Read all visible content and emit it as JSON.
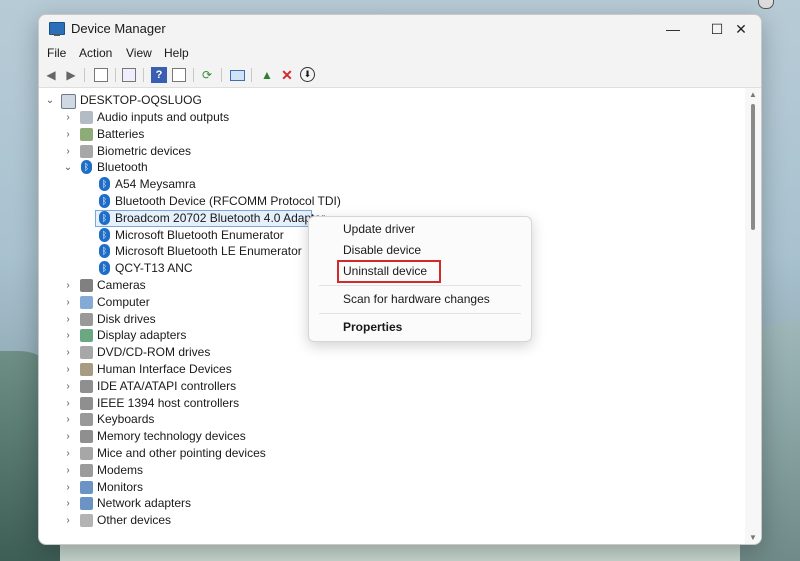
{
  "window": {
    "title": "Device Manager",
    "controls": {
      "minimize": "—",
      "maximize": "☐",
      "close": "✕"
    }
  },
  "menubar": [
    "File",
    "Action",
    "View",
    "Help"
  ],
  "toolbar": {
    "buttons": [
      "back-icon",
      "forward-icon",
      "properties-icon",
      "list-icon",
      "help-icon",
      "details-icon",
      "scan-icon",
      "monitor-icon",
      "update-driver-icon",
      "uninstall-icon",
      "download-icon"
    ],
    "uninstall_color": "#d22a2a"
  },
  "tree": {
    "root": "DESKTOP-OQSLUOG",
    "categories": [
      {
        "label": "Audio inputs and outputs",
        "icon": "speaker-icon",
        "expanded": false
      },
      {
        "label": "Batteries",
        "icon": "battery-icon",
        "expanded": false
      },
      {
        "label": "Biometric devices",
        "icon": "fingerprint-icon",
        "expanded": false
      },
      {
        "label": "Bluetooth",
        "icon": "bluetooth-icon",
        "expanded": true,
        "children": [
          {
            "label": "A54 Meysamra"
          },
          {
            "label": "Bluetooth Device (RFCOMM Protocol TDI)"
          },
          {
            "label": "Broadcom 20702 Bluetooth 4.0 Adapter",
            "selected": true
          },
          {
            "label": "Microsoft Bluetooth Enumerator"
          },
          {
            "label": "Microsoft Bluetooth LE Enumerator"
          },
          {
            "label": "QCY-T13 ANC"
          }
        ]
      },
      {
        "label": "Cameras",
        "icon": "camera-icon",
        "expanded": false
      },
      {
        "label": "Computer",
        "icon": "computer-icon",
        "expanded": false
      },
      {
        "label": "Disk drives",
        "icon": "disk-drive-icon",
        "expanded": false
      },
      {
        "label": "Display adapters",
        "icon": "display-adapter-icon",
        "expanded": false
      },
      {
        "label": "DVD/CD-ROM drives",
        "icon": "dvd-drive-icon",
        "expanded": false
      },
      {
        "label": "Human Interface Devices",
        "icon": "hid-icon",
        "expanded": false
      },
      {
        "label": "IDE ATA/ATAPI controllers",
        "icon": "ide-controller-icon",
        "expanded": false
      },
      {
        "label": "IEEE 1394 host controllers",
        "icon": "ieee1394-icon",
        "expanded": false
      },
      {
        "label": "Keyboards",
        "icon": "keyboard-icon",
        "expanded": false
      },
      {
        "label": "Memory technology devices",
        "icon": "memory-icon",
        "expanded": false
      },
      {
        "label": "Mice and other pointing devices",
        "icon": "mouse-icon",
        "expanded": false
      },
      {
        "label": "Modems",
        "icon": "modem-icon",
        "expanded": false
      },
      {
        "label": "Monitors",
        "icon": "monitor-icon",
        "expanded": false
      },
      {
        "label": "Network adapters",
        "icon": "network-adapter-icon",
        "expanded": false
      },
      {
        "label": "Other devices",
        "icon": "other-devices-icon",
        "expanded": false
      }
    ]
  },
  "context_menu": {
    "items": [
      {
        "label": "Update driver"
      },
      {
        "label": "Disable device"
      },
      {
        "label": "Uninstall device",
        "highlighted": true
      },
      {
        "label": "Scan for hardware changes"
      },
      {
        "label": "Properties",
        "bold": true
      }
    ],
    "highlight_color": "#d22a2a"
  },
  "colors": {
    "bluetooth": "#1e6ec8",
    "selection": "#e5f0fb"
  }
}
